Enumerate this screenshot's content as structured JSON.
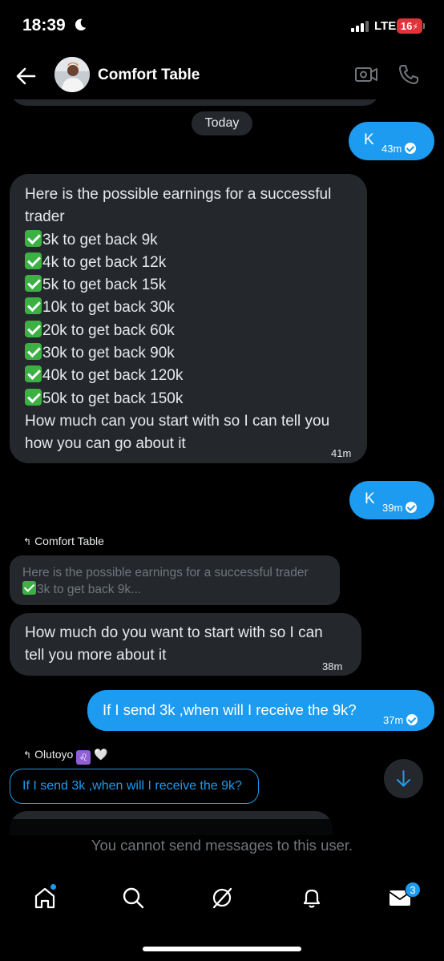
{
  "status_bar": {
    "time": "18:39",
    "network": "LTE",
    "battery": "16",
    "battery_color": "#e0343a"
  },
  "header": {
    "contact_name": "Comfort Table",
    "icons": [
      "back-arrow-icon",
      "video-call-icon",
      "phone-icon"
    ]
  },
  "date_separator": "Today",
  "colors": {
    "outgoing_bubble": "#1d9bf0",
    "incoming_bubble": "#24282d",
    "background": "#000000",
    "muted_text": "#71767b"
  },
  "messages": {
    "out_1": {
      "text": "K",
      "time": "43m"
    },
    "in_1": {
      "intro_line_1": "Here is the possible earnings for a successful",
      "intro_line_2": "trader",
      "items": [
        "3k to get back 9k",
        "4k to get back 12k",
        "5k to get back 15k",
        "10k to get back 30k",
        "20k to get back 60k",
        "30k to get back 90k",
        "40k to get back 120k",
        "50k to get back 150k"
      ],
      "outro_line_1": "How much can you start with so I can tell you",
      "outro_line_2": "how you can go about it",
      "time": "41m"
    },
    "out_2": {
      "text": "K",
      "time": "39m"
    },
    "reply_1": {
      "replying_to": "Comfort Table",
      "quoted_line_1": "Here is the possible earnings for a successful trader",
      "quoted_line_2": "3k to get back 9k..."
    },
    "in_2": {
      "line_1": "How much do you want to start with so I can",
      "line_2": "tell you more about it",
      "time": "38m"
    },
    "out_3": {
      "text": "If I send 3k ,when will I receive the 9k?",
      "time": "37m"
    },
    "reply_2": {
      "replying_to": "Olutoyo",
      "emoji_suffix": "🤍",
      "quoted": "If I send 3k ,when will I receive the 9k?"
    }
  },
  "notice": "You cannot send messages to this user.",
  "bottom_nav": {
    "items": [
      "home-icon",
      "search-icon",
      "grok-icon",
      "notifications-icon",
      "messages-icon"
    ],
    "messages_badge": "3"
  }
}
